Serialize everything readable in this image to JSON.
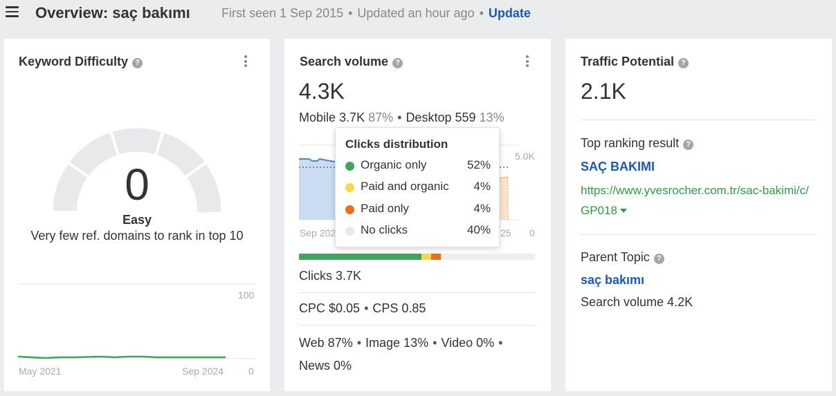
{
  "header": {
    "title": "Overview: saç bakımı",
    "first_seen": "First seen 1 Sep 2015",
    "updated": "Updated an hour ago",
    "update_link": "Update"
  },
  "kd_card": {
    "title": "Keyword Difficulty",
    "help": "?",
    "value": "0",
    "label": "Easy",
    "description": "Very few ref. domains to rank in top 10",
    "chart": {
      "y_max_label": "100",
      "y_min_label": "0",
      "x_start_label": "May 2021",
      "x_end_label": "Sep 2024"
    }
  },
  "sv_card": {
    "title": "Search volume",
    "help": "?",
    "volume": "4.3K",
    "mobile_label": "Mobile",
    "mobile_value": "3.7K",
    "mobile_pct": "87%",
    "desktop_label": "Desktop",
    "desktop_value": "559",
    "desktop_pct": "13%",
    "chart": {
      "y_max_label": "5.0K",
      "y_min_label": "0",
      "x_start_label": "Sep 202",
      "x_end_label": "25"
    },
    "clicks": "Clicks 3.7K",
    "cpc": "CPC $0.05",
    "cps": "CPS 0.85",
    "serp_line1": [
      "Web 87%",
      "Image 13%",
      "Video 0%"
    ],
    "serp_line2": "News 0%"
  },
  "clicks_tooltip": {
    "title": "Clicks distribution",
    "rows": [
      {
        "label": "Organic only",
        "pct": "52%",
        "color": "#3da55d"
      },
      {
        "label": "Paid and organic",
        "pct": "4%",
        "color": "#f5d94b"
      },
      {
        "label": "Paid only",
        "pct": "4%",
        "color": "#ef6c1a"
      },
      {
        "label": "No clicks",
        "pct": "40%",
        "color": "#e9e9e9"
      }
    ]
  },
  "tp_card": {
    "title": "Traffic Potential",
    "help": "?",
    "value": "2.1K",
    "top_result_label": "Top ranking result",
    "top_result_title": "SAÇ BAKIMI",
    "top_result_url": "https://www.yvesrocher.com.tr/sac-bakimi/c/GP018",
    "parent_topic_label": "Parent Topic",
    "parent_topic": "saç bakımı",
    "parent_volume": "Search volume 4.2K"
  }
}
